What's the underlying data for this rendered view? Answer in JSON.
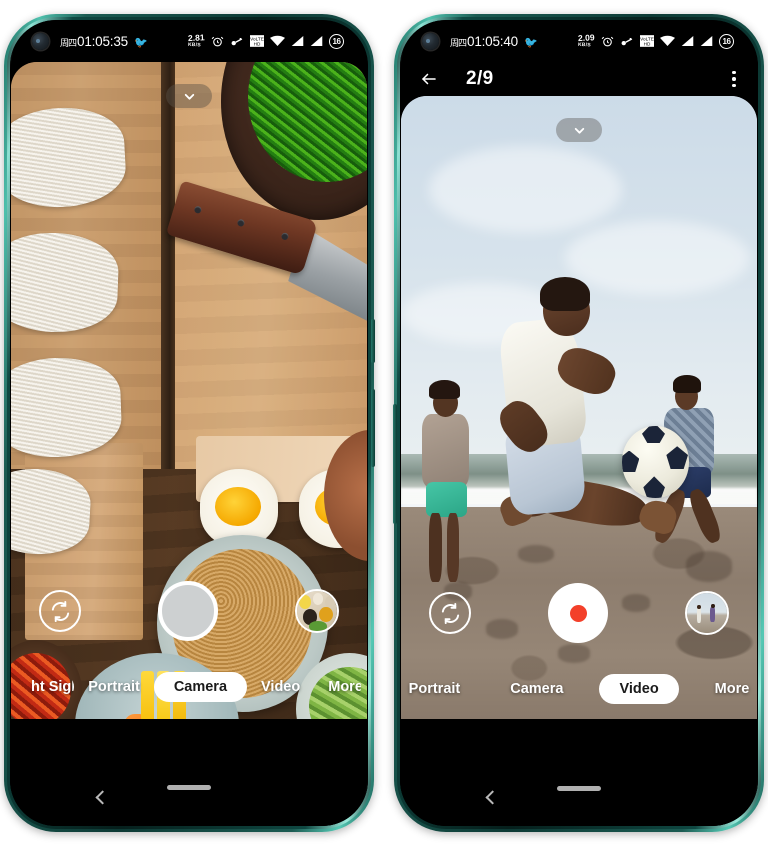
{
  "left_phone": {
    "status_bar": {
      "day": "周四",
      "time": "01:05:35",
      "emoji": "🐦",
      "net_speed_value": "2.81",
      "net_speed_unit": "KB/S",
      "icons": [
        "alarm-clock-icon",
        "key-icon",
        "volte-icon",
        "wifi-icon",
        "signal-icon",
        "signal2-icon"
      ],
      "battery_percent": "16"
    },
    "viewfinder": {
      "expand_control": "chevron-down-icon",
      "scene": "food-photo"
    },
    "controls": {
      "flip_camera": "camera-flip-icon",
      "shutter": "shutter-button",
      "gallery_thumb": "spices-thumbnail"
    },
    "modes": [
      {
        "label": "ht Sight",
        "selected": false
      },
      {
        "label": "Portrait",
        "selected": false
      },
      {
        "label": "Camera",
        "selected": true
      },
      {
        "label": "Video",
        "selected": false
      },
      {
        "label": "More",
        "selected": false
      }
    ],
    "navbar": {
      "back": "back-icon",
      "home": "home-indicator"
    }
  },
  "right_phone": {
    "status_bar": {
      "day": "周四",
      "time": "01:05:40",
      "emoji": "🐦",
      "net_speed_value": "2.09",
      "net_speed_unit": "KB/S",
      "icons": [
        "alarm-clock-icon",
        "key-icon",
        "volte-icon",
        "wifi-icon",
        "signal-icon",
        "signal2-icon"
      ],
      "battery_percent": "16"
    },
    "sub_header": {
      "back": "back-arrow-icon",
      "title": "2/9",
      "overflow": "more-vert-icon"
    },
    "viewfinder": {
      "expand_control": "chevron-down-icon",
      "scene": "beach-football-photo"
    },
    "controls": {
      "flip_camera": "camera-flip-icon",
      "record": "record-button",
      "gallery_thumb": "beach-thumbnail"
    },
    "modes": [
      {
        "label": "Portrait",
        "selected": false
      },
      {
        "label": "Camera",
        "selected": false
      },
      {
        "label": "Video",
        "selected": true
      },
      {
        "label": "More",
        "selected": false
      }
    ],
    "navbar": {
      "back": "back-icon",
      "home": "home-indicator"
    }
  },
  "colors": {
    "frame": "#1b6f62",
    "record_dot": "#f3402a",
    "selected_pill": "#ffffff",
    "screen_black": "#000000"
  }
}
